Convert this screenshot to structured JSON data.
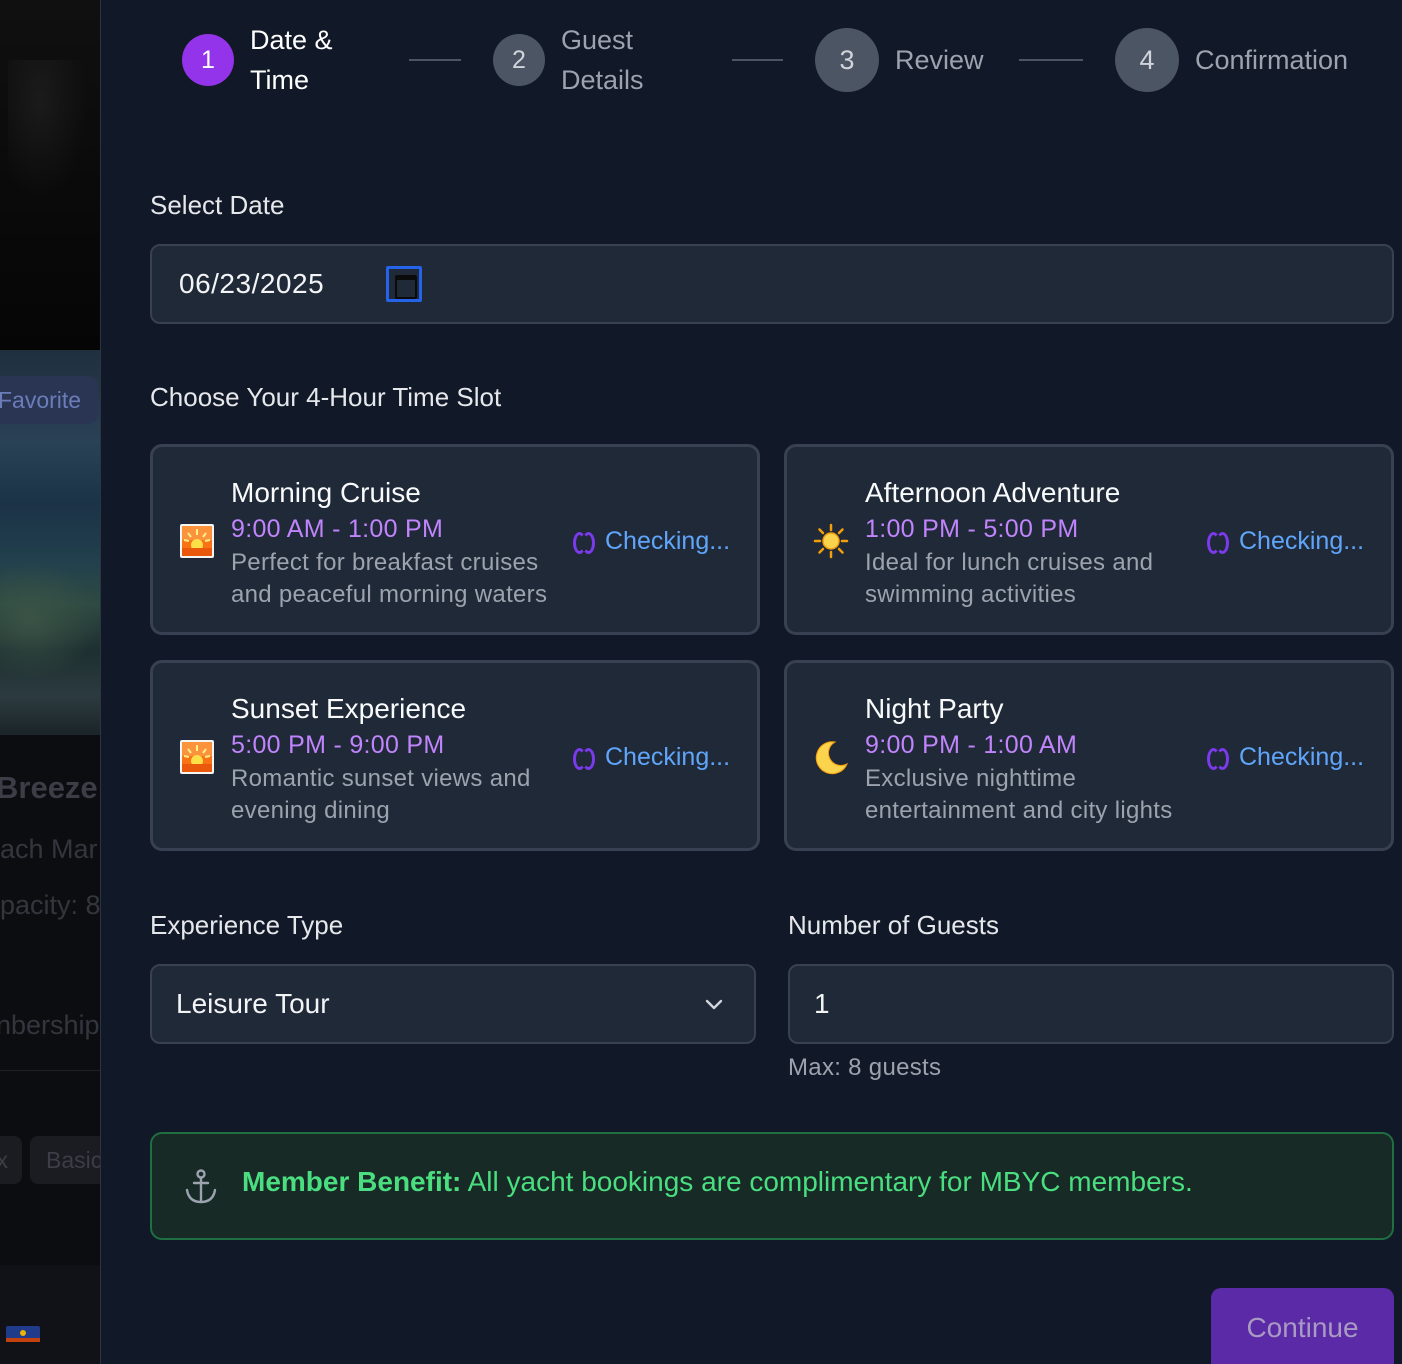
{
  "background": {
    "badge": "Favorite",
    "title": "Breeze",
    "line1": "ach Mar",
    "line2": "pacity: 8",
    "line3": "nbership",
    "chip_a": "x",
    "chip_b": "Basic"
  },
  "stepper": {
    "steps": [
      {
        "number": "1",
        "label_line1": "Date &",
        "label_line2": "Time",
        "state": "active"
      },
      {
        "number": "2",
        "label_line1": "Guest",
        "label_line2": "Details",
        "state": "pending"
      },
      {
        "number": "3",
        "label": "Review",
        "state": "pending"
      },
      {
        "number": "4",
        "label": "Confirmation",
        "state": "pending"
      }
    ]
  },
  "date": {
    "label": "Select Date",
    "value": "06/23/2025"
  },
  "time_slots": {
    "label": "Choose Your 4-Hour Time Slot",
    "slots": [
      {
        "title": "Morning Cruise",
        "time": "9:00 AM - 1:00 PM",
        "description": "Perfect for breakfast cruises and peaceful morning waters",
        "status": "Checking...",
        "icon": "sunrise-icon"
      },
      {
        "title": "Afternoon Adventure",
        "time": "1:00 PM - 5:00 PM",
        "description": "Ideal for lunch cruises and swimming activities",
        "status": "Checking...",
        "icon": "sun-icon"
      },
      {
        "title": "Sunset Experience",
        "time": "5:00 PM - 9:00 PM",
        "description": "Romantic sunset views and evening dining",
        "status": "Checking...",
        "icon": "sunset-icon"
      },
      {
        "title": "Night Party",
        "time": "9:00 PM - 1:00 AM",
        "description": "Exclusive nighttime entertainment and city lights",
        "status": "Checking...",
        "icon": "moon-icon"
      }
    ]
  },
  "experience": {
    "label": "Experience Type",
    "selected": "Leisure Tour"
  },
  "guests": {
    "label": "Number of Guests",
    "value": "1",
    "hint": "Max: 8 guests"
  },
  "benefit": {
    "strong": "Member Benefit:",
    "text": " All yacht bookings are complimentary for MBYC members."
  },
  "actions": {
    "continue_label": "Continue"
  },
  "colors": {
    "accent": "#9333ea",
    "time": "#c084fc",
    "status": "#60a5fa",
    "benefit": "#4ade80",
    "modal_bg": "#111827",
    "field_bg": "#1f2937"
  }
}
